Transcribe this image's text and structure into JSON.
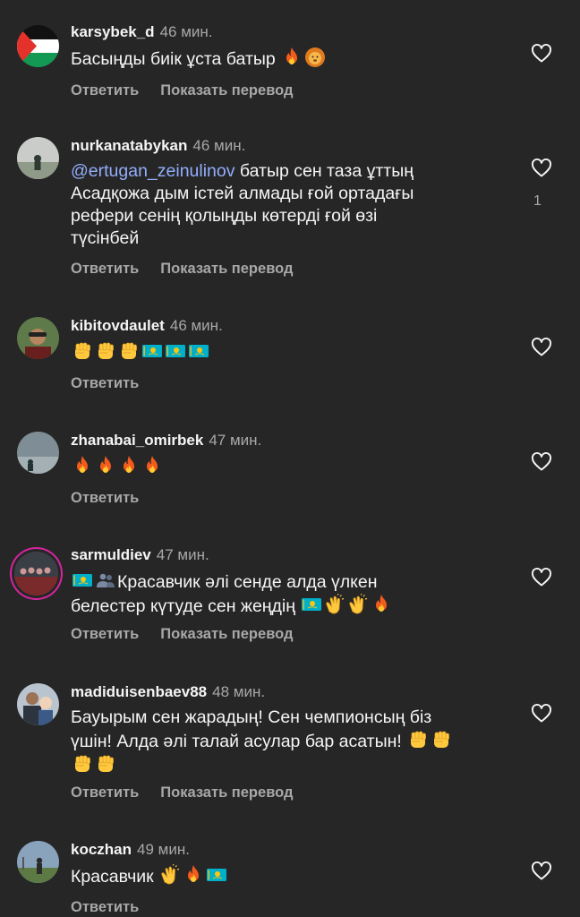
{
  "comments": [
    {
      "username": "karsybek_d",
      "time": "46 мин.",
      "text": "Басыңды биік ұста батыр",
      "emoji": [
        "fire-emoji",
        "lion-emoji"
      ],
      "reply": "Ответить",
      "translate": "Показать перевод"
    },
    {
      "username": "nurkanatabykan",
      "time": "46 мин.",
      "mention": "@ertugan_zeinulinov",
      "text_lines": [
        "батыр сен таза ұттың",
        "Асадқожа дым істей алмады ғой ортадағы",
        "рефери сенің қолыңды көтерді ғой өзі",
        "түсінбей"
      ],
      "likes": "1",
      "reply": "Ответить",
      "translate": "Показать перевод"
    },
    {
      "username": "kibitovdaulet",
      "time": "46 мин.",
      "emoji": [
        "raised-fist-emoji",
        "raised-fist-emoji",
        "raised-fist-emoji",
        "kazakhstan-flag-emoji",
        "kazakhstan-flag-emoji",
        "kazakhstan-flag-emoji"
      ],
      "reply": "Ответить"
    },
    {
      "username": "zhanabai_omirbek",
      "time": "47 мин.",
      "emoji": [
        "fire-emoji",
        "fire-emoji",
        "fire-emoji",
        "fire-emoji"
      ],
      "reply": "Ответить"
    },
    {
      "username": "sarmuldiev",
      "time": "47 мин.",
      "line1": "Красавчик әлі сенде алда үлкен",
      "line2": "белестер күтуде сен жеңдің",
      "reply": "Ответить",
      "translate": "Показать перевод"
    },
    {
      "username": "madiduisenbaev88",
      "time": "48 мин.",
      "line1": "Бауырым сен жарадың! Сен чемпионсың біз",
      "line2": "үшін! Алда әлі талай асулар бар асатын!",
      "reply": "Ответить",
      "translate": "Показать перевод"
    },
    {
      "username": "koczhan",
      "time": "49 мин.",
      "text": "Красавчик",
      "reply": "Ответить"
    }
  ],
  "colors": {
    "background": "#262626",
    "text": "#f5f5f5",
    "secondary": "#a8a8a8",
    "mention": "#92aefc"
  }
}
